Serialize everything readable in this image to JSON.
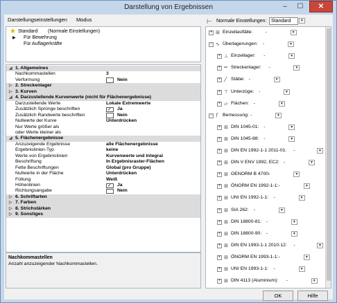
{
  "window": {
    "title": "Darstellung von Ergebnissen",
    "minimize": "–",
    "maximize": "☐",
    "close": "✕"
  },
  "menu": {
    "items": [
      "Darstellungseinstellungen",
      "Modus"
    ]
  },
  "presets": {
    "items": [
      {
        "name": "Standard",
        "note": "(Normale Einstellungen)"
      },
      {
        "name": "Für Bewehrung",
        "note": ""
      },
      {
        "name": "Für Auflagerkräfte",
        "note": ""
      }
    ]
  },
  "properties": {
    "rows": [
      {
        "type": "section",
        "label": "1. Allgemeines",
        "expanded": true
      },
      {
        "type": "prop",
        "label": "Nachkommastellen",
        "value": "3"
      },
      {
        "type": "check",
        "label": "Verformung",
        "checked": false,
        "value": "Nein"
      },
      {
        "type": "section",
        "label": "2. Streckenlager",
        "expanded": false
      },
      {
        "type": "section",
        "label": "3. Kurven",
        "expanded": false
      },
      {
        "type": "section",
        "label": "4. Darzustellende Kurvenwerte (nicht für Flächenergebnisse)",
        "expanded": true
      },
      {
        "type": "prop",
        "label": "Darzustellende Werte",
        "value": "Lokale Extremwerte"
      },
      {
        "type": "check",
        "label": "Zusätzlich Sprünge beschriften",
        "checked": true,
        "value": "Ja"
      },
      {
        "type": "check",
        "label": "Zusätzlich Randwerte beschriften",
        "checked": false,
        "value": "Nein"
      },
      {
        "type": "prop",
        "label": "Nullwerte der Kurve",
        "value": "Unterdrücken"
      },
      {
        "type": "prop",
        "label": "Nur Werte größer als",
        "value": ""
      },
      {
        "type": "prop",
        "label": "oder Werte kleiner als",
        "value": ""
      },
      {
        "type": "section",
        "label": "5. Flächenergebnisse",
        "expanded": true
      },
      {
        "type": "prop",
        "label": "Anzuzeigende Ergebnisse",
        "value": "alle Flächenergebnisse"
      },
      {
        "type": "prop",
        "label": "Ergebnislinien-Typ",
        "value": "keine"
      },
      {
        "type": "prop",
        "label": "Werte von Ergebnislinien",
        "value": "Kurvenwerte und Integral"
      },
      {
        "type": "prop",
        "label": "Beschriftung",
        "value": "In Ergebnisraster-Flächen"
      },
      {
        "type": "prop",
        "label": "Fette Beschriftungen",
        "value": "Global (pro Gruppe)"
      },
      {
        "type": "prop",
        "label": "Nullwerte in der Fläche",
        "value": "Unterdrücken"
      },
      {
        "type": "prop",
        "label": "Füllung",
        "value": "Weiß"
      },
      {
        "type": "check",
        "label": "Höhenlinien",
        "checked": true,
        "value": "Ja"
      },
      {
        "type": "check",
        "label": "Richtungsangabe",
        "checked": false,
        "value": "Nein"
      },
      {
        "type": "section",
        "label": "6. Schriftarten",
        "expanded": false
      },
      {
        "type": "section",
        "label": "7. Farben",
        "expanded": false
      },
      {
        "type": "section",
        "label": "8. Strichstärken",
        "expanded": false
      },
      {
        "type": "section",
        "label": "9. Sonstiges",
        "expanded": false
      }
    ]
  },
  "description": {
    "title": "Nachkommastellen",
    "text": "Anzahl anzuzeigender Nachkommastellen."
  },
  "right": {
    "settings_label": "Normale Einstellungen:",
    "settings_value": "Standard",
    "tree": [
      {
        "level": 0,
        "label": "Einzellastfälle:",
        "value": "-",
        "exp": "+",
        "icon": "load-icon"
      },
      {
        "level": 0,
        "label": "Überlagerungen:",
        "value": "-",
        "exp": "−",
        "icon": "overlay-icon"
      },
      {
        "level": 1,
        "label": "Einzellager:",
        "value": "-",
        "exp": "+",
        "icon": "support-icon"
      },
      {
        "level": 1,
        "label": "Streckenlager:",
        "value": "-",
        "exp": "+",
        "icon": "line-support-icon"
      },
      {
        "level": 1,
        "label": "Stäbe:",
        "value": "-",
        "exp": "+",
        "icon": "beam-icon"
      },
      {
        "level": 1,
        "label": "Unterzüge:",
        "value": "-",
        "exp": "+",
        "icon": "downstand-icon"
      },
      {
        "level": 1,
        "label": "Flächen:",
        "value": "-",
        "exp": "+",
        "icon": "surface-icon"
      },
      {
        "level": 0,
        "label": "Bemessung:",
        "value": "-",
        "exp": "−",
        "icon": "design-icon"
      },
      {
        "level": 1,
        "label": "DIN 1045-01:",
        "value": "-",
        "exp": "+",
        "icon": "norm-icon"
      },
      {
        "level": 1,
        "label": "DIN 1045-88:",
        "value": "-",
        "exp": "+",
        "icon": "norm-icon"
      },
      {
        "level": 1,
        "label": "DIN EN 1992-1-1 2011-01:",
        "value": "-",
        "exp": "+",
        "icon": "norm-icon"
      },
      {
        "level": 1,
        "label": "DIN V ENV 1992, EC2:",
        "value": "-",
        "exp": "+",
        "icon": "norm-icon"
      },
      {
        "level": 1,
        "label": "OENORM B 4700:",
        "value": "-",
        "exp": "+",
        "icon": "norm-icon"
      },
      {
        "level": 1,
        "label": "ÖNORM EN 1992-1-1:",
        "value": "-",
        "exp": "+",
        "icon": "norm-icon"
      },
      {
        "level": 1,
        "label": "UNI EN 1992-1-1:",
        "value": "-",
        "exp": "+",
        "icon": "norm-icon"
      },
      {
        "level": 1,
        "label": "SIA 262:",
        "value": "-",
        "exp": "+",
        "icon": "norm-icon"
      },
      {
        "level": 1,
        "label": "DIN 18800-81:",
        "value": "-",
        "exp": "+",
        "icon": "norm-icon"
      },
      {
        "level": 1,
        "label": "DIN 18800-90:",
        "value": "-",
        "exp": "+",
        "icon": "norm-icon"
      },
      {
        "level": 1,
        "label": "DIN EN 1993-1-1 2010-12:",
        "value": "-",
        "exp": "+",
        "icon": "norm-icon"
      },
      {
        "level": 1,
        "label": "ÖNORM EN 1993-1-1:",
        "value": "-",
        "exp": "+",
        "icon": "norm-icon"
      },
      {
        "level": 1,
        "label": "UNI EN 1993-1-1:",
        "value": "-",
        "exp": "+",
        "icon": "norm-icon"
      },
      {
        "level": 1,
        "label": "DIN 4113 (Aluminium):",
        "value": "-",
        "exp": "+",
        "icon": "norm-icon"
      }
    ]
  },
  "buttons": {
    "ok": "OK",
    "help": "Hilfe"
  },
  "colors": {
    "window_frame": "#c4d6ea",
    "close_button": "#c9463d",
    "section_bg": "#dcdcdc",
    "check_green": "#1a8a1a",
    "star": "#e8b300"
  }
}
